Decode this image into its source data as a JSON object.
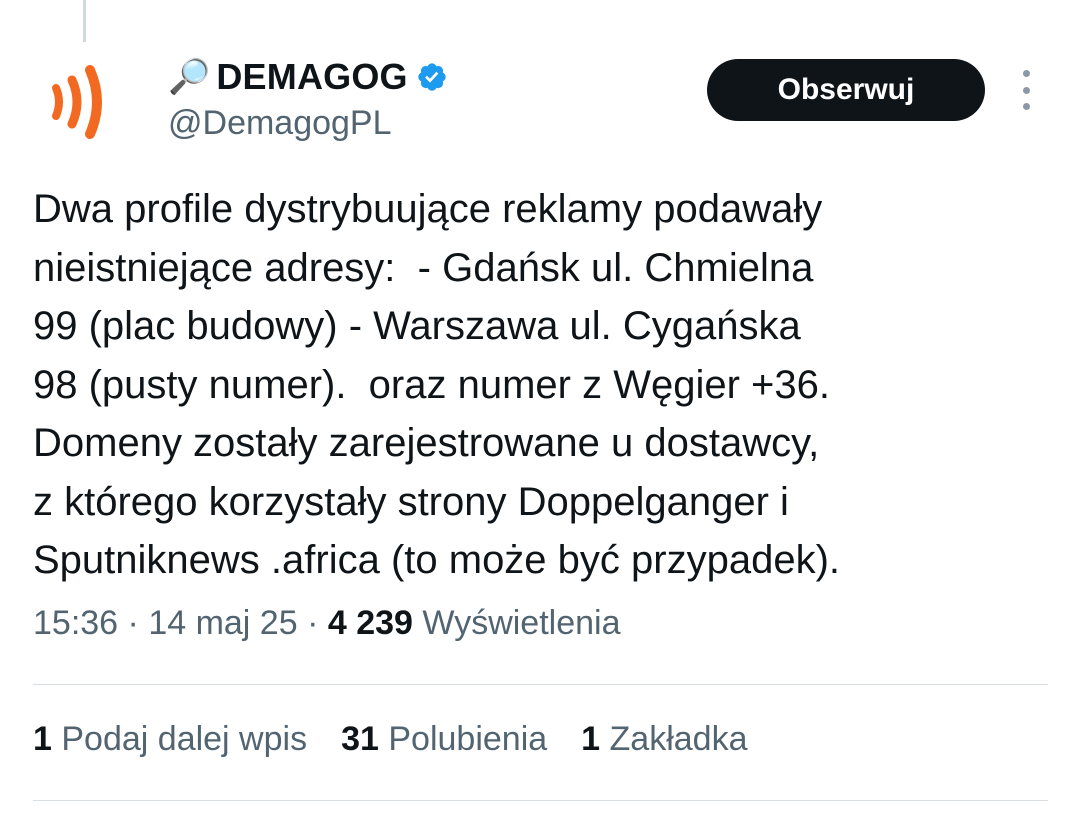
{
  "tweet": {
    "author": {
      "emoji": "🔎",
      "display_name": "DEMAGOG",
      "handle": "@DemagogPL",
      "verified_icon": "verified-badge-icon",
      "avatar_icon": "signal-waves-logo",
      "brand_color": "#f26a21",
      "verified_color": "#1d9bf0"
    },
    "follow_label": "Obserwuj",
    "more_icon": "vertical-dots-icon",
    "text": "Dwa profile dystrybuujące reklamy podawały\nnieistniejące adresy:  - Gdańsk ul. Chmielna\n99 (plac budowy) - Warszawa ul. Cygańska\n98 (pusty numer).  oraz numer z Węgier +36.\nDomeny zostały zarejestrowane u dostawcy,\nz którego korzystały strony Doppelganger i\nSputniknews .africa (to może być przypadek).",
    "meta": {
      "time": "15:36",
      "separator": " · ",
      "date": "14 maj 25",
      "views_count": "4 239",
      "views_label": "Wyświetlenia"
    },
    "stats": {
      "reposts_count": "1",
      "reposts_label": "Podaj dalej wpis",
      "likes_count": "31",
      "likes_label": "Polubienia",
      "bookmarks_count": "1",
      "bookmarks_label": "Zakładka"
    }
  }
}
